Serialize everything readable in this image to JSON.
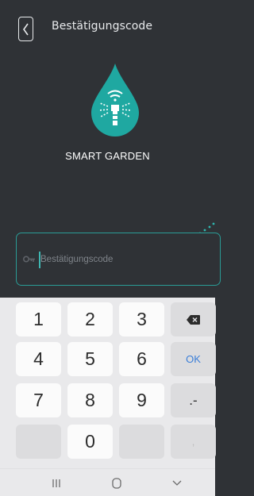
{
  "header": {
    "title": "Bestätigungscode",
    "back_icon": "chevron-left-icon"
  },
  "logo": {
    "icon": "water-drop-sprinkler-icon",
    "brand_name": "SMART GARDEN",
    "color": "#1fa8a1"
  },
  "code_field": {
    "placeholder": "Bestätigungscode",
    "icon": "key-icon",
    "accent": "#2a9c96"
  },
  "keyboard": {
    "rows": [
      [
        "1",
        "2",
        "3",
        "⌫"
      ],
      [
        "4",
        "5",
        "6",
        "OK"
      ],
      [
        "7",
        "8",
        "9",
        ".-"
      ],
      [
        "",
        "0",
        "",
        ","
      ]
    ],
    "ok_color": "#3a7ed8"
  },
  "navigation": {
    "recent_icon": "recent-apps-icon",
    "home_icon": "home-icon",
    "back_icon": "nav-back-icon"
  }
}
